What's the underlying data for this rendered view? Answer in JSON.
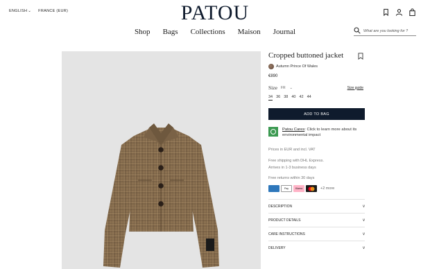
{
  "header": {
    "language": "ENGLISH",
    "region": "FRANCE (EUR)",
    "brand": "PATOU"
  },
  "nav": {
    "items": [
      "Shop",
      "Bags",
      "Collections",
      "Maison",
      "Journal"
    ]
  },
  "search": {
    "placeholder": "What are you looking for ?"
  },
  "product": {
    "title": "Cropped buttoned jacket",
    "color_name": "Autumn Prince Of Wales",
    "price": "€890",
    "size_label": "Size",
    "size_system": "FR",
    "size_guide": "Size guide",
    "sizes": [
      "34",
      "36",
      "38",
      "40",
      "42",
      "44"
    ],
    "add_to_bag": "ADD TO BAG",
    "cares_link": "Patou Cares",
    "cares_text": ": Click to learn more about its environmental impact",
    "prices_note": "Prices in EUR and incl. VAT",
    "shipping_line1": "Free shipping with DHL Express.",
    "shipping_line2": "Arrives in 1-3 business days",
    "returns": "Free returns within 30 days",
    "payment_more": "+2 more",
    "payments": [
      {
        "name": "Amex",
        "color": "#2e77bb"
      },
      {
        "name": "Pay",
        "color": "#ffffff"
      },
      {
        "name": "Klarna",
        "color": "#ffb3c7"
      },
      {
        "name": "Mastercard",
        "color": "#1a1a1a"
      }
    ],
    "accordion": [
      {
        "label": "DESCRIPTION",
        "icon": "v"
      },
      {
        "label": "PRODUCT DETAILS",
        "icon": "v"
      },
      {
        "label": "CARE INSTRUCTIONS",
        "icon": "v"
      },
      {
        "label": "DELIVERY",
        "icon": "v"
      }
    ]
  },
  "colors": {
    "brand_navy": "#0f1b2d",
    "cares_green": "#3c9a52",
    "gallery_bg": "#e4e4e4"
  }
}
